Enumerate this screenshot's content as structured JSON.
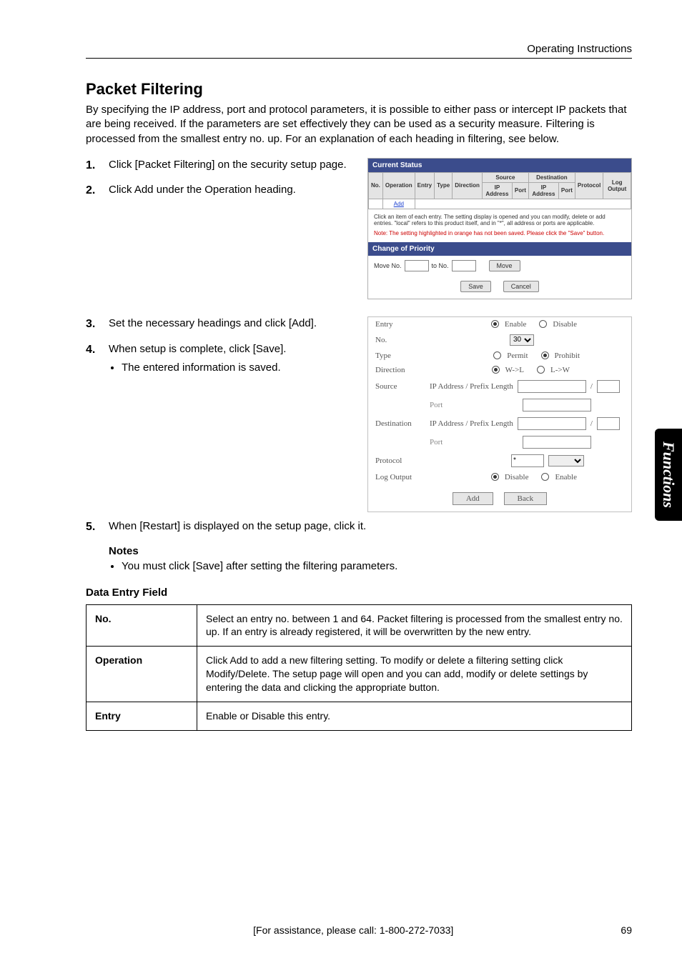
{
  "header": {
    "section": "Operating Instructions"
  },
  "title": "Packet Filtering",
  "intro": "By specifying the IP address, port and protocol parameters, it is possible to either pass or intercept IP packets that are being received. If the parameters are set effectively they can be used as a security measure. Filtering is processed from the smallest entry no. up. For an explanation of each heading in filtering, see below.",
  "steps": {
    "s1": {
      "num": "1.",
      "text": "Click [Packet Filtering] on the security setup page."
    },
    "s2": {
      "num": "2.",
      "text": "Click Add under the Operation heading."
    },
    "s3": {
      "num": "3.",
      "text": "Set the necessary headings and click [Add]."
    },
    "s4": {
      "num": "4.",
      "text": "When setup is complete, click [Save].",
      "bullet": "The entered information is saved."
    },
    "s5": {
      "num": "5.",
      "text": "When [Restart] is displayed on the setup page, click it."
    }
  },
  "notes": {
    "heading": "Notes",
    "n1": "You must click [Save] after setting the filtering parameters."
  },
  "dataEntryHeading": "Data Entry Field",
  "fields": {
    "no": {
      "label": "No.",
      "desc": "Select an entry no. between 1 and 64. Packet filtering is processed from the smallest entry no. up. If an entry is already registered, it will be overwritten by the new entry."
    },
    "op": {
      "label": "Operation",
      "desc": "Click Add to add a new filtering setting. To modify or delete a filtering setting click Modify/Delete. The setup page will open and you can add, modify or delete settings by entering the data and clicking the appropriate button."
    },
    "entry": {
      "label": "Entry",
      "desc": "Enable or Disable this entry."
    }
  },
  "footer": {
    "assist": "[For assistance, please call: 1-800-272-7033]",
    "page": "69"
  },
  "sideTab": "Functions",
  "shot1": {
    "title": "Current Status",
    "cols": {
      "no": "No.",
      "operation": "Operation",
      "entry": "Entry",
      "type": "Type",
      "direction": "Direction",
      "source": "Source",
      "sourceIP": "IP Address",
      "sourcePort": "Port",
      "dest": "Destination",
      "destIP": "IP Address",
      "destPort": "Port",
      "protocol": "Protocol",
      "log": "Log Output"
    },
    "addLink": "Add",
    "caption": "Click an item of each entry. The setting display is opened and you can modify, delete or add entries. \"local\" refers to this product itself, and in \"*\", all address or ports are applicable.",
    "note": "Note: The setting highlighted in orange has not been saved. Please click the \"Save\" button.",
    "priorityTitle": "Change of Priority",
    "moveLabel": "Move No.",
    "toLabel": "to No.",
    "moveBtn": "Move",
    "saveBtn": "Save",
    "cancelBtn": "Cancel"
  },
  "shot2": {
    "entry": {
      "label": "Entry",
      "opt1": "Enable",
      "opt2": "Disable"
    },
    "no": {
      "label": "No.",
      "value": "30"
    },
    "type": {
      "label": "Type",
      "opt1": "Permit",
      "opt2": "Prohibit"
    },
    "direction": {
      "label": "Direction",
      "opt1": "W->L",
      "opt2": "L->W"
    },
    "source": {
      "label": "Source",
      "sub": "IP Address / Prefix Length",
      "port": "Port"
    },
    "dest": {
      "label": "Destination",
      "sub": "IP Address / Prefix Length",
      "port": "Port"
    },
    "protocol": {
      "label": "Protocol",
      "value": "*"
    },
    "logoutput": {
      "label": "Log Output",
      "opt1": "Disable",
      "opt2": "Enable"
    },
    "addBtn": "Add",
    "backBtn": "Back"
  }
}
